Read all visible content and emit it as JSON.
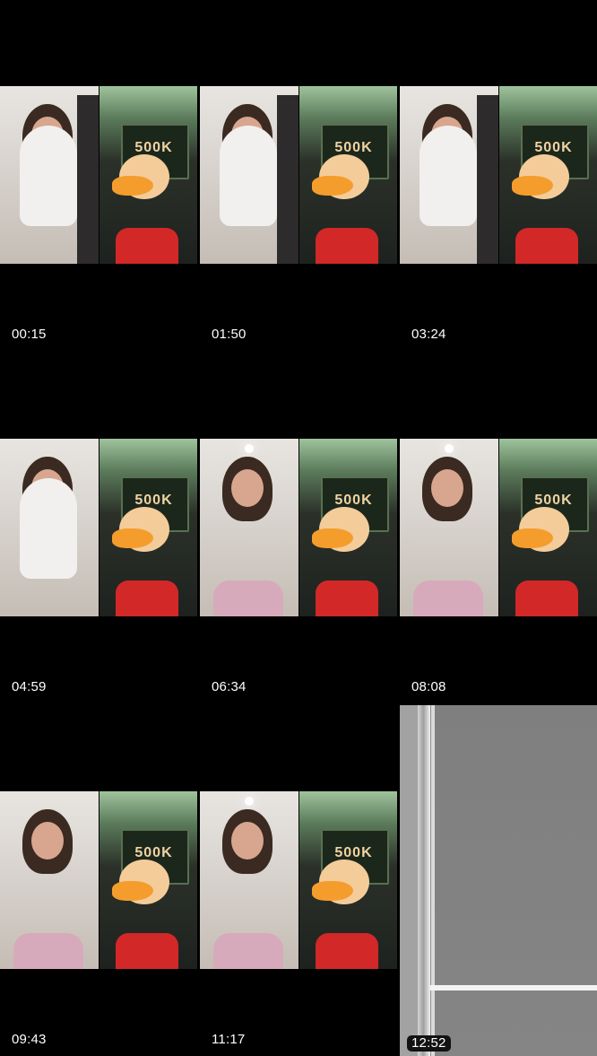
{
  "thumbnails": [
    {
      "time": "00:15"
    },
    {
      "time": "01:50"
    },
    {
      "time": "03:24"
    },
    {
      "time": "04:59"
    },
    {
      "time": "06:34"
    },
    {
      "time": "08:08"
    },
    {
      "time": "09:43"
    },
    {
      "time": "11:17"
    },
    {
      "time": "12:52"
    }
  ],
  "sign_text": "500K"
}
